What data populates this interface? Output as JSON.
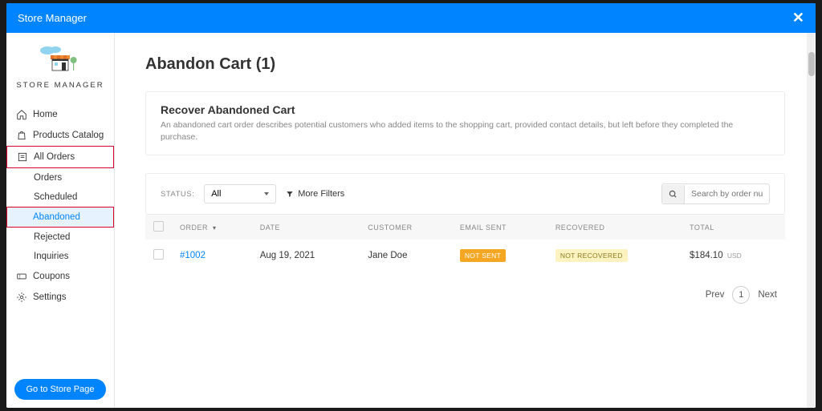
{
  "header": {
    "title": "Store Manager"
  },
  "sidebar": {
    "logo_label": "STORE MANAGER",
    "items": {
      "home": "Home",
      "products": "Products Catalog",
      "all_orders": "All Orders",
      "orders": "Orders",
      "scheduled": "Scheduled",
      "abandoned": "Abandoned",
      "rejected": "Rejected",
      "inquiries": "Inquiries",
      "coupons": "Coupons",
      "settings": "Settings"
    },
    "go_store": "Go to Store Page"
  },
  "main": {
    "title": "Abandon Cart (1)",
    "info_title": "Recover Abandoned Cart",
    "info_desc": "An abandoned cart order describes potential customers who added items to the shopping cart, provided contact details, but left before they completed the purchase.",
    "status_label": "STATUS:",
    "status_value": "All",
    "more_filters": "More Filters",
    "search_placeholder": "Search by order number, cu",
    "cols": {
      "order": "ORDER",
      "date": "DATE",
      "customer": "CUSTOMER",
      "email_sent": "EMAIL SENT",
      "recovered": "RECOVERED",
      "total": "TOTAL"
    },
    "row": {
      "order": "#1002",
      "date": "Aug 19, 2021",
      "customer": "Jane Doe",
      "email_sent": "NOT SENT",
      "recovered": "NOT RECOVERED",
      "total": "$184.10",
      "currency": "USD"
    },
    "pagination": {
      "prev": "Prev",
      "page": "1",
      "next": "Next"
    }
  }
}
